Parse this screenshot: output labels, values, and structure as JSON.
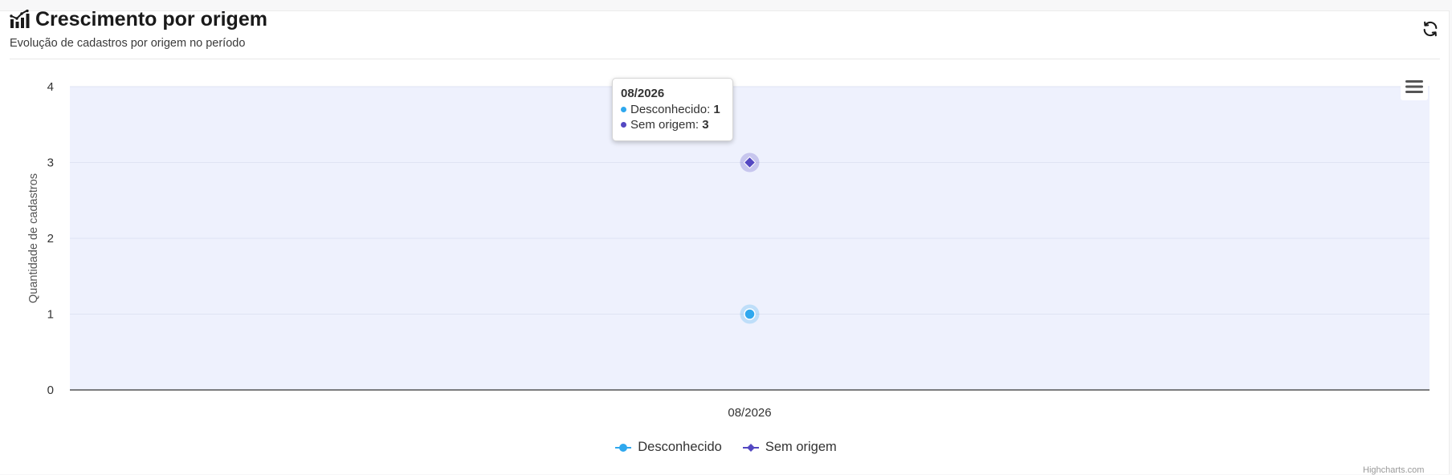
{
  "header": {
    "title": "Crescimento por origem",
    "subtitle": "Evolução de cadastros por origem no período"
  },
  "colors": {
    "plot_background": "#eef1fd",
    "gridline": "#dfe3f3",
    "axis_line": "#333333",
    "series_desconhecido": "#2fa8ee",
    "series_sem_origem": "#5448c2"
  },
  "icons": {
    "title": "chart-bar-icon",
    "refresh": "refresh-icon",
    "menu": "hamburger-menu-icon"
  },
  "chart_data": {
    "type": "line",
    "categories": [
      "08/2026"
    ],
    "series": [
      {
        "name": "Desconhecido",
        "values": [
          1
        ],
        "marker": "circle",
        "color": "#2fa8ee"
      },
      {
        "name": "Sem origem",
        "values": [
          3
        ],
        "marker": "diamond",
        "color": "#5448c2"
      }
    ],
    "ylabel": "Quantidade de cadastros",
    "ylim": [
      0,
      4
    ],
    "yticks": [
      0,
      1,
      2,
      3,
      4
    ],
    "grid": true,
    "legend_position": "bottom-center",
    "tooltip": {
      "header": "08/2026",
      "rows": [
        {
          "label": "Desconhecido",
          "value": "1"
        },
        {
          "label": "Sem origem",
          "value": "3"
        }
      ]
    },
    "credits": "Highcharts.com"
  }
}
